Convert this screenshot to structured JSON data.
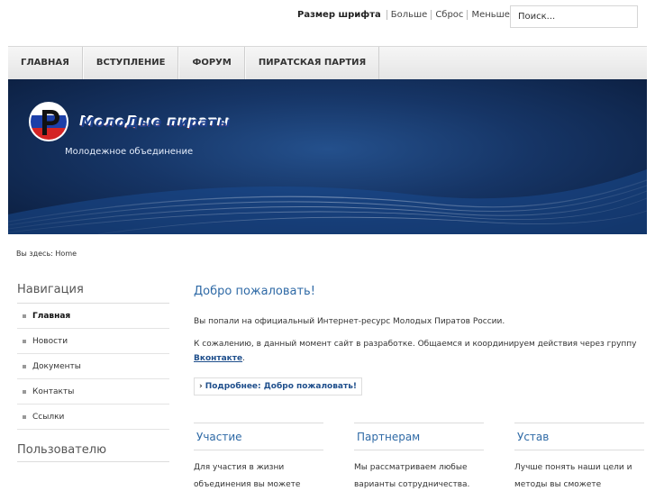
{
  "top": {
    "font_size_label": "Размер шрифта",
    "font_links": [
      "Больше",
      "Сброс",
      "Меньше"
    ],
    "search_placeholder": "Поиск..."
  },
  "nav": {
    "items": [
      "ГЛАВНАЯ",
      "ВСТУПЛЕНИЕ",
      "ФОРУМ",
      "ПИРАТСКАЯ ПАРТИЯ"
    ]
  },
  "header": {
    "logo_text": "МолоДые пираты",
    "tagline": "Молодежное объединение"
  },
  "breadcrumb": {
    "text": "Вы здесь: Home"
  },
  "sidebar": {
    "title": "Навигация",
    "items": [
      {
        "label": "Главная",
        "active": true
      },
      {
        "label": "Новости",
        "active": false
      },
      {
        "label": "Документы",
        "active": false
      },
      {
        "label": "Контакты",
        "active": false
      },
      {
        "label": "Ссылки",
        "active": false
      }
    ],
    "title2": "Пользователю"
  },
  "main": {
    "title": "Добро пожаловать!",
    "p1": "Вы попали на официальный Интернет-ресурс Молодых Пиратов России.",
    "p2": "К сожалению, в данный момент сайт в разработке. Общаемся и координируем действия через группу",
    "vk_link": "Вконтакте",
    "p2_end": ".",
    "readmore": "Подробнее: Добро пожаловать!"
  },
  "columns": [
    {
      "title": "Участие",
      "text1": "Для участия в жизни",
      "text2": "объединения вы можете"
    },
    {
      "title": "Партнерам",
      "text1": "Мы рассматриваем любые",
      "text2": "варианты сотрудничества."
    },
    {
      "title": "Устав",
      "text1": "Лучше понять наши цели и",
      "text2": "методы вы сможете"
    }
  ],
  "colors": {
    "accent_link": "#2f6aa6",
    "banner_dark": "#0b1d3d",
    "banner_mid": "#24508c"
  }
}
